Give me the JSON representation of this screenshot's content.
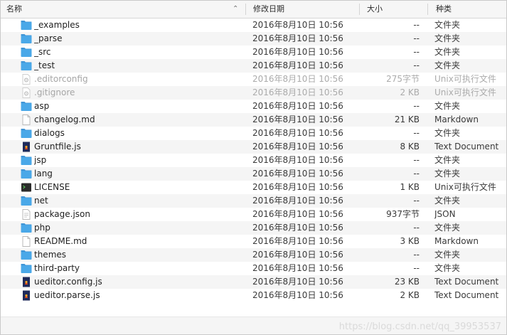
{
  "header": {
    "name": "名称",
    "date": "修改日期",
    "size": "大小",
    "kind": "种类"
  },
  "colors": {
    "folder": "#4aa8e8",
    "folder_tab": "#3f95d6",
    "dim_text": "#a6a6a6"
  },
  "rows": [
    {
      "name": "_examples",
      "date": "2016年8月10日 10:56",
      "size": "--",
      "kind": "文件夹",
      "icon": "folder-icon",
      "dim": false
    },
    {
      "name": "_parse",
      "date": "2016年8月10日 10:56",
      "size": "--",
      "kind": "文件夹",
      "icon": "folder-icon",
      "dim": false
    },
    {
      "name": "_src",
      "date": "2016年8月10日 10:56",
      "size": "--",
      "kind": "文件夹",
      "icon": "folder-icon",
      "dim": false
    },
    {
      "name": "_test",
      "date": "2016年8月10日 10:56",
      "size": "--",
      "kind": "文件夹",
      "icon": "folder-icon",
      "dim": false
    },
    {
      "name": ".editorconfig",
      "date": "2016年8月10日 10:56",
      "size": "275字节",
      "kind": "Unix可执行文件",
      "icon": "gear-file-icon",
      "dim": true
    },
    {
      "name": ".gitignore",
      "date": "2016年8月10日 10:56",
      "size": "2 KB",
      "kind": "Unix可执行文件",
      "icon": "gear-file-icon",
      "dim": true
    },
    {
      "name": "asp",
      "date": "2016年8月10日 10:56",
      "size": "--",
      "kind": "文件夹",
      "icon": "folder-icon",
      "dim": false
    },
    {
      "name": "changelog.md",
      "date": "2016年8月10日 10:56",
      "size": "21 KB",
      "kind": "Markdown",
      "icon": "blank-file-icon",
      "dim": false
    },
    {
      "name": "dialogs",
      "date": "2016年8月10日 10:56",
      "size": "--",
      "kind": "文件夹",
      "icon": "folder-icon",
      "dim": false
    },
    {
      "name": "Gruntfile.js",
      "date": "2016年8月10日 10:56",
      "size": "8 KB",
      "kind": "Text Document",
      "icon": "js-file-icon",
      "dim": false
    },
    {
      "name": "jsp",
      "date": "2016年8月10日 10:56",
      "size": "--",
      "kind": "文件夹",
      "icon": "folder-icon",
      "dim": false
    },
    {
      "name": "lang",
      "date": "2016年8月10日 10:56",
      "size": "--",
      "kind": "文件夹",
      "icon": "folder-icon",
      "dim": false
    },
    {
      "name": "LICENSE",
      "date": "2016年8月10日 10:56",
      "size": "1 KB",
      "kind": "Unix可执行文件",
      "icon": "terminal-icon",
      "dim": false
    },
    {
      "name": "net",
      "date": "2016年8月10日 10:56",
      "size": "--",
      "kind": "文件夹",
      "icon": "folder-icon",
      "dim": false
    },
    {
      "name": "package.json",
      "date": "2016年8月10日 10:56",
      "size": "937字节",
      "kind": "JSON",
      "icon": "text-file-icon",
      "dim": false
    },
    {
      "name": "php",
      "date": "2016年8月10日 10:56",
      "size": "--",
      "kind": "文件夹",
      "icon": "folder-icon",
      "dim": false
    },
    {
      "name": "README.md",
      "date": "2016年8月10日 10:56",
      "size": "3 KB",
      "kind": "Markdown",
      "icon": "blank-file-icon",
      "dim": false
    },
    {
      "name": "themes",
      "date": "2016年8月10日 10:56",
      "size": "--",
      "kind": "文件夹",
      "icon": "folder-icon",
      "dim": false
    },
    {
      "name": "third-party",
      "date": "2016年8月10日 10:56",
      "size": "--",
      "kind": "文件夹",
      "icon": "folder-icon",
      "dim": false
    },
    {
      "name": "ueditor.config.js",
      "date": "2016年8月10日 10:56",
      "size": "23 KB",
      "kind": "Text Document",
      "icon": "js-file-icon",
      "dim": false
    },
    {
      "name": "ueditor.parse.js",
      "date": "2016年8月10日 10:56",
      "size": "2 KB",
      "kind": "Text Document",
      "icon": "js-file-icon",
      "dim": false
    }
  ],
  "watermark": "https://blog.csdn.net/qq_39953537"
}
